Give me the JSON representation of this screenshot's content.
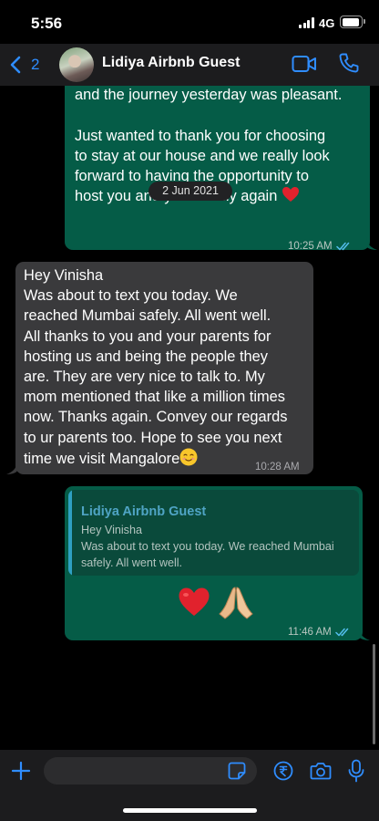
{
  "status_bar": {
    "time": "5:56",
    "network": "4G"
  },
  "header": {
    "back_count": "2",
    "contact_name": "Lidiya Airbnb Guest"
  },
  "chat": {
    "date_pill": "2 Jun 2021",
    "messages": [
      {
        "direction": "outgoing",
        "text": "Hope you guys have reached home safe\nand the journey yesterday was pleasant.\n\nJust wanted to thank you for choosing\nto stay at our house and we really look\nforward to having the opportunity to\nhost you and your family again",
        "emoji": "red-heart",
        "time": "10:25 AM",
        "status": "read"
      },
      {
        "direction": "incoming",
        "text": "Hey Vinisha\nWas about to text you today. We\nreached Mumbai safely. All went well.\nAll thanks to you and your parents for\nhosting us and being the people they\nare. They are very nice to talk to. My\nmom mentioned that like a million times\nnow. Thanks again. Convey our regards\nto ur parents too. Hope to see you next\ntime we visit Mangalore",
        "emoji": "smiling-face",
        "time": "10:28 AM"
      },
      {
        "direction": "outgoing",
        "quote": {
          "author": "Lidiya Airbnb Guest",
          "text": "Hey Vinisha\nWas about to text you today. We reached Mumbai\nsafely. All went well."
        },
        "emojis": [
          "red-heart",
          "folded-hands"
        ],
        "time": "11:46 AM",
        "status": "read"
      }
    ]
  },
  "composer": {
    "placeholder": ""
  },
  "colors": {
    "outgoing_bubble": "#055c47",
    "incoming_bubble": "#3a3a3c",
    "accent_blue": "#2f8dff",
    "read_ticks": "#53bdeb",
    "quote_author": "#4fa4c4"
  },
  "icons": [
    "chevron-left-icon",
    "video-camera-icon",
    "phone-icon",
    "plus-icon",
    "sticker-icon",
    "rupee-icon",
    "camera-icon",
    "microphone-icon",
    "double-check-icon"
  ]
}
